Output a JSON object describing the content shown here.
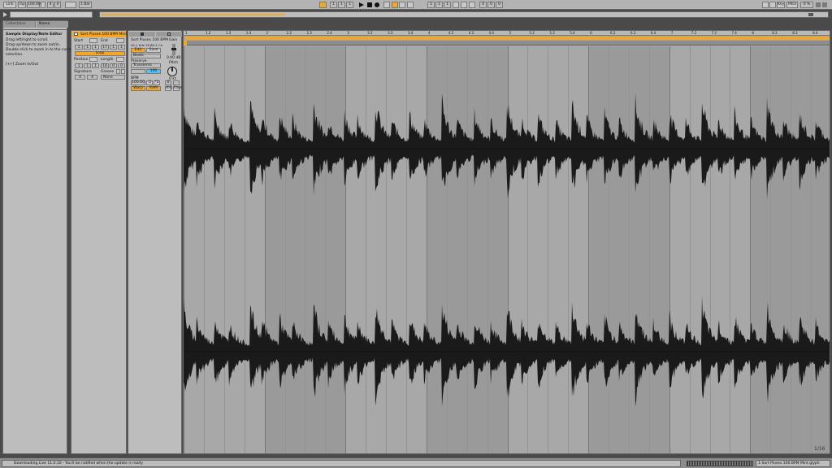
{
  "toolbar": {
    "link": "Link",
    "tap": "Tap",
    "tempo": "100.00",
    "sig_num": "4",
    "sig_den": "4",
    "quant": "1 Bar",
    "position": [
      "1",
      "1",
      "1"
    ],
    "loop_pos": [
      "1",
      "1",
      "1"
    ],
    "loop_len": [
      "4",
      "0",
      "0"
    ],
    "key": "Key",
    "midi": "MIDI",
    "cpu": "0 %"
  },
  "browser": {
    "tab_collections": "Collections",
    "tab_name": "Name",
    "info_title": "Sample Display/Note Editor",
    "info_lines": [
      "Drag left/right to scroll.",
      "Drag up/down to zoom out/in.",
      "Double-click to zoom in to the current",
      "selection.",
      "",
      "[+/-] Zoom In/Out"
    ]
  },
  "clip": {
    "name": "Sort Pluses 100 BPM Mint",
    "start_label": "Start",
    "end_label": "End",
    "start_vals": [
      "1",
      "1",
      "1"
    ],
    "end_vals": [
      "17",
      "1",
      "1"
    ],
    "loop_label": "Loop",
    "position_label": "Position",
    "length_label": "Length",
    "position_vals": [
      "1",
      "1",
      "1"
    ],
    "length_vals": [
      "16",
      "0",
      "0"
    ],
    "signature_label": "Signature",
    "groove_label": "Groove",
    "sig_vals": [
      "4",
      "4"
    ],
    "groove_val": "None"
  },
  "sample": {
    "name": "Sort Pluses 100 BPM",
    "info": "44.1 kHz  16 Bit  2 Ch",
    "edit": "Edit",
    "save": "Save",
    "warp": "Warp",
    "mode": "Beats",
    "preserve_label": "Preserve",
    "preserve_val": "Transients",
    "envelope": "100",
    "bpm_label": "BPM",
    "bpm_val": "100.00",
    "half": ":2",
    "double": "*2",
    "seg_bpm": "Seg. BPM",
    "gain_label": "Gain",
    "gain_val": "0.00 dB",
    "pitch_label": "Pitch",
    "pitch_val": "0 st",
    "pitch_fine": "0",
    "hiq": "HiQ",
    "fade": "Fade",
    "ram": "RAM",
    "rev": "Rev"
  },
  "ruler": {
    "labels": [
      "1",
      "1.2",
      "1.3",
      "1.4",
      "2",
      "2.2",
      "2.3",
      "2.4",
      "3",
      "3.2",
      "3.3",
      "3.4",
      "4",
      "4.2",
      "4.3",
      "4.4",
      "5",
      "5.2",
      "5.3",
      "5.4",
      "6",
      "6.2",
      "6.3",
      "6.4",
      "7",
      "7.2",
      "7.3",
      "7.4",
      "8",
      "8.2",
      "8.3",
      "8.4"
    ]
  },
  "editor": {
    "zoom": "1/16"
  },
  "status": {
    "message": "Downloading Live 11.0.10 - You'll be notified when the update is ready",
    "clip_name": "1-Sort Pluses 100 BPM Mint glyph"
  },
  "colors": {
    "accent": "#f5a623",
    "background": "#a6a6a6",
    "waveform": "#1a1a1a"
  }
}
